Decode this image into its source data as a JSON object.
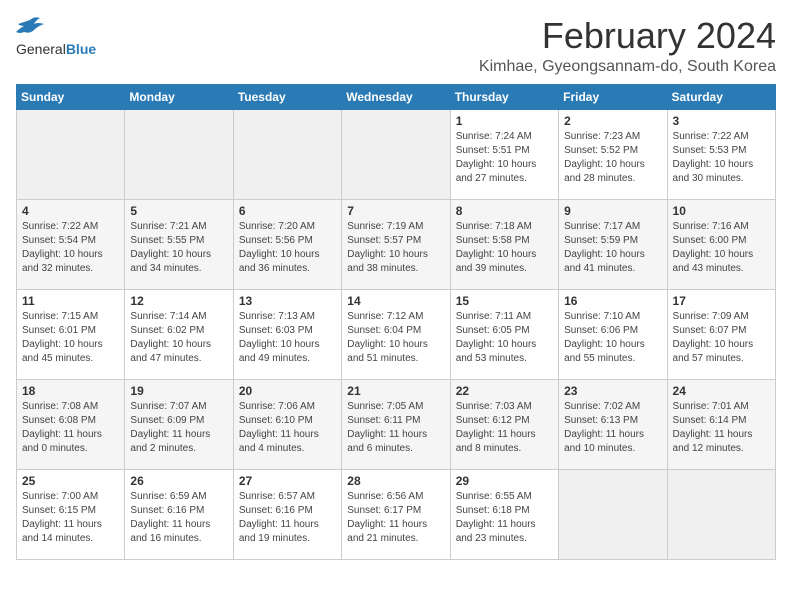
{
  "header": {
    "logo_general": "General",
    "logo_blue": "Blue",
    "month_year": "February 2024",
    "location": "Kimhae, Gyeongsannam-do, South Korea"
  },
  "weekdays": [
    "Sunday",
    "Monday",
    "Tuesday",
    "Wednesday",
    "Thursday",
    "Friday",
    "Saturday"
  ],
  "weeks": [
    [
      {
        "day": "",
        "info": ""
      },
      {
        "day": "",
        "info": ""
      },
      {
        "day": "",
        "info": ""
      },
      {
        "day": "",
        "info": ""
      },
      {
        "day": "1",
        "info": "Sunrise: 7:24 AM\nSunset: 5:51 PM\nDaylight: 10 hours and 27 minutes."
      },
      {
        "day": "2",
        "info": "Sunrise: 7:23 AM\nSunset: 5:52 PM\nDaylight: 10 hours and 28 minutes."
      },
      {
        "day": "3",
        "info": "Sunrise: 7:22 AM\nSunset: 5:53 PM\nDaylight: 10 hours and 30 minutes."
      }
    ],
    [
      {
        "day": "4",
        "info": "Sunrise: 7:22 AM\nSunset: 5:54 PM\nDaylight: 10 hours and 32 minutes."
      },
      {
        "day": "5",
        "info": "Sunrise: 7:21 AM\nSunset: 5:55 PM\nDaylight: 10 hours and 34 minutes."
      },
      {
        "day": "6",
        "info": "Sunrise: 7:20 AM\nSunset: 5:56 PM\nDaylight: 10 hours and 36 minutes."
      },
      {
        "day": "7",
        "info": "Sunrise: 7:19 AM\nSunset: 5:57 PM\nDaylight: 10 hours and 38 minutes."
      },
      {
        "day": "8",
        "info": "Sunrise: 7:18 AM\nSunset: 5:58 PM\nDaylight: 10 hours and 39 minutes."
      },
      {
        "day": "9",
        "info": "Sunrise: 7:17 AM\nSunset: 5:59 PM\nDaylight: 10 hours and 41 minutes."
      },
      {
        "day": "10",
        "info": "Sunrise: 7:16 AM\nSunset: 6:00 PM\nDaylight: 10 hours and 43 minutes."
      }
    ],
    [
      {
        "day": "11",
        "info": "Sunrise: 7:15 AM\nSunset: 6:01 PM\nDaylight: 10 hours and 45 minutes."
      },
      {
        "day": "12",
        "info": "Sunrise: 7:14 AM\nSunset: 6:02 PM\nDaylight: 10 hours and 47 minutes."
      },
      {
        "day": "13",
        "info": "Sunrise: 7:13 AM\nSunset: 6:03 PM\nDaylight: 10 hours and 49 minutes."
      },
      {
        "day": "14",
        "info": "Sunrise: 7:12 AM\nSunset: 6:04 PM\nDaylight: 10 hours and 51 minutes."
      },
      {
        "day": "15",
        "info": "Sunrise: 7:11 AM\nSunset: 6:05 PM\nDaylight: 10 hours and 53 minutes."
      },
      {
        "day": "16",
        "info": "Sunrise: 7:10 AM\nSunset: 6:06 PM\nDaylight: 10 hours and 55 minutes."
      },
      {
        "day": "17",
        "info": "Sunrise: 7:09 AM\nSunset: 6:07 PM\nDaylight: 10 hours and 57 minutes."
      }
    ],
    [
      {
        "day": "18",
        "info": "Sunrise: 7:08 AM\nSunset: 6:08 PM\nDaylight: 11 hours and 0 minutes."
      },
      {
        "day": "19",
        "info": "Sunrise: 7:07 AM\nSunset: 6:09 PM\nDaylight: 11 hours and 2 minutes."
      },
      {
        "day": "20",
        "info": "Sunrise: 7:06 AM\nSunset: 6:10 PM\nDaylight: 11 hours and 4 minutes."
      },
      {
        "day": "21",
        "info": "Sunrise: 7:05 AM\nSunset: 6:11 PM\nDaylight: 11 hours and 6 minutes."
      },
      {
        "day": "22",
        "info": "Sunrise: 7:03 AM\nSunset: 6:12 PM\nDaylight: 11 hours and 8 minutes."
      },
      {
        "day": "23",
        "info": "Sunrise: 7:02 AM\nSunset: 6:13 PM\nDaylight: 11 hours and 10 minutes."
      },
      {
        "day": "24",
        "info": "Sunrise: 7:01 AM\nSunset: 6:14 PM\nDaylight: 11 hours and 12 minutes."
      }
    ],
    [
      {
        "day": "25",
        "info": "Sunrise: 7:00 AM\nSunset: 6:15 PM\nDaylight: 11 hours and 14 minutes."
      },
      {
        "day": "26",
        "info": "Sunrise: 6:59 AM\nSunset: 6:16 PM\nDaylight: 11 hours and 16 minutes."
      },
      {
        "day": "27",
        "info": "Sunrise: 6:57 AM\nSunset: 6:16 PM\nDaylight: 11 hours and 19 minutes."
      },
      {
        "day": "28",
        "info": "Sunrise: 6:56 AM\nSunset: 6:17 PM\nDaylight: 11 hours and 21 minutes."
      },
      {
        "day": "29",
        "info": "Sunrise: 6:55 AM\nSunset: 6:18 PM\nDaylight: 11 hours and 23 minutes."
      },
      {
        "day": "",
        "info": ""
      },
      {
        "day": "",
        "info": ""
      }
    ]
  ]
}
